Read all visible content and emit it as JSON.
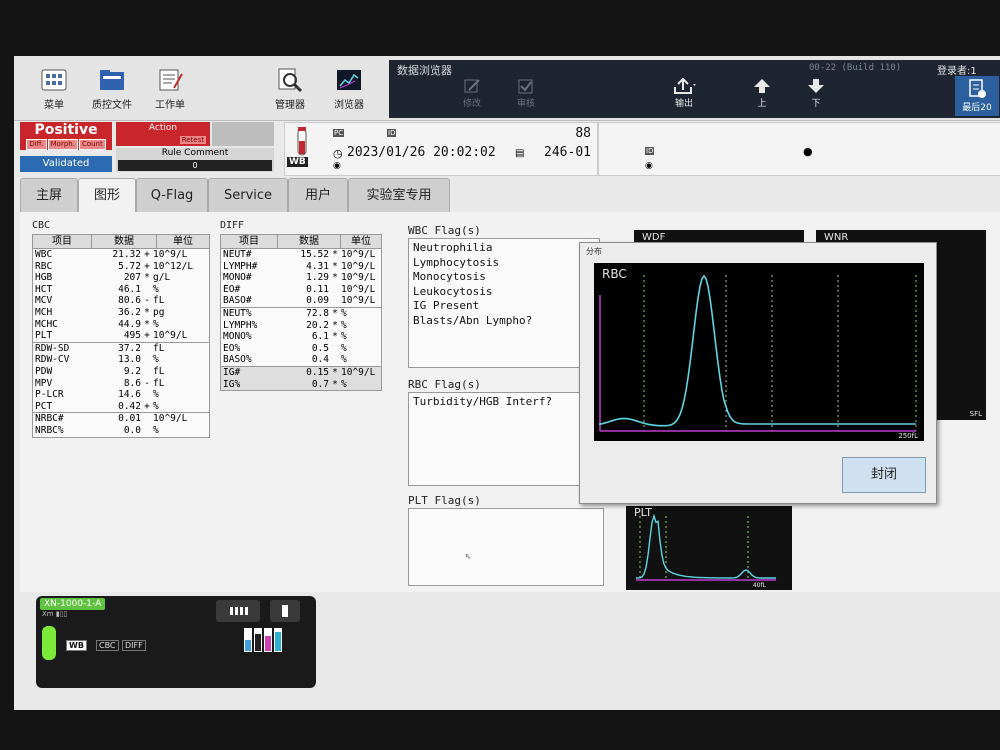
{
  "toolbar": {
    "items": [
      {
        "label": "菜单",
        "icon": "menu-grid-icon"
      },
      {
        "label": "质控文件",
        "icon": "qc-folder-icon"
      },
      {
        "label": "工作单",
        "icon": "worklist-icon"
      },
      {
        "label": "管理器",
        "icon": "manager-magnifier-icon"
      },
      {
        "label": "浏览器",
        "icon": "browser-chart-icon"
      }
    ]
  },
  "browser_bar": {
    "title": "数据浏览器",
    "build": "00-22 (Build 110)",
    "registered": "登录者:1",
    "actions": [
      {
        "label": "修改",
        "enabled": false
      },
      {
        "label": "审核",
        "enabled": false
      },
      {
        "label": "输出",
        "enabled": true
      },
      {
        "label": "上",
        "enabled": true
      },
      {
        "label": "下",
        "enabled": true
      }
    ],
    "last20_label": "最后20"
  },
  "status": {
    "result": "Positive",
    "chips": [
      "Diff.",
      "Morph.",
      "Count"
    ],
    "validated": "Validated",
    "action": "Action",
    "retest": "Retest",
    "rule_comment_label": "Rule Comment",
    "rule_comment_value": "0"
  },
  "sample": {
    "type": "WB",
    "seq": "88",
    "datetime": "2023/01/26 20:02:02",
    "rack": "246-01"
  },
  "tabs": [
    "主屏",
    "图形",
    "Q-Flag",
    "Service",
    "用户",
    "实验室专用"
  ],
  "active_tab": "图形",
  "cbc": {
    "title": "CBC",
    "headers": [
      "项目",
      "数据",
      "单位"
    ],
    "rows": [
      {
        "name": "WBC",
        "value": "21.32",
        "flag": "+",
        "unit": "10^9/L"
      },
      {
        "name": "RBC",
        "value": "5.72",
        "flag": "+",
        "unit": "10^12/L"
      },
      {
        "name": "HGB",
        "value": "207",
        "flag": "*",
        "unit": "g/L"
      },
      {
        "name": "HCT",
        "value": "46.1",
        "flag": "",
        "unit": "%"
      },
      {
        "name": "MCV",
        "value": "80.6",
        "flag": "-",
        "unit": "fL"
      },
      {
        "name": "MCH",
        "value": "36.2",
        "flag": "*",
        "unit": "pg"
      },
      {
        "name": "MCHC",
        "value": "44.9",
        "flag": "*",
        "unit": "%"
      },
      {
        "name": "PLT",
        "value": "495",
        "flag": "+",
        "unit": "10^9/L"
      },
      {
        "name": "RDW-SD",
        "value": "37.2",
        "flag": "",
        "unit": "fL"
      },
      {
        "name": "RDW-CV",
        "value": "13.0",
        "flag": "",
        "unit": "%"
      },
      {
        "name": "PDW",
        "value": "9.2",
        "flag": "",
        "unit": "fL"
      },
      {
        "name": "MPV",
        "value": "8.6",
        "flag": "-",
        "unit": "fL"
      },
      {
        "name": "P-LCR",
        "value": "14.6",
        "flag": "",
        "unit": "%"
      },
      {
        "name": "PCT",
        "value": "0.42",
        "flag": "+",
        "unit": "%"
      },
      {
        "name": "NRBC#",
        "value": "0.01",
        "flag": "",
        "unit": "10^9/L"
      },
      {
        "name": "NRBC%",
        "value": "0.0",
        "flag": "",
        "unit": "%"
      }
    ]
  },
  "diff": {
    "title": "DIFF",
    "headers": [
      "项目",
      "数据",
      "单位"
    ],
    "rows": [
      {
        "name": "NEUT#",
        "value": "15.52",
        "flag": "*",
        "unit": "10^9/L"
      },
      {
        "name": "LYMPH#",
        "value": "4.31",
        "flag": "*",
        "unit": "10^9/L"
      },
      {
        "name": "MONO#",
        "value": "1.29",
        "flag": "*",
        "unit": "10^9/L"
      },
      {
        "name": "EO#",
        "value": "0.11",
        "flag": "",
        "unit": "10^9/L"
      },
      {
        "name": "BASO#",
        "value": "0.09",
        "flag": "",
        "unit": "10^9/L"
      },
      {
        "name": "NEUT%",
        "value": "72.8",
        "flag": "*",
        "unit": "%"
      },
      {
        "name": "LYMPH%",
        "value": "20.2",
        "flag": "*",
        "unit": "%"
      },
      {
        "name": "MONO%",
        "value": "6.1",
        "flag": "*",
        "unit": "%"
      },
      {
        "name": "EO%",
        "value": "0.5",
        "flag": "",
        "unit": "%"
      },
      {
        "name": "BASO%",
        "value": "0.4",
        "flag": "",
        "unit": "%"
      },
      {
        "name": "IG#",
        "value": "0.15",
        "flag": "*",
        "unit": "10^9/L"
      },
      {
        "name": "IG%",
        "value": "0.7",
        "flag": "*",
        "unit": "%"
      }
    ]
  },
  "wbc_flags": {
    "title": "WBC Flag(s)",
    "items": [
      "Neutrophilia",
      "Lymphocytosis",
      "Monocytosis",
      "Leukocytosis",
      "IG Present",
      "Blasts/Abn Lympho?"
    ]
  },
  "rbc_flags": {
    "title": "RBC Flag(s)",
    "items": [
      "Turbidity/HGB Interf?"
    ]
  },
  "plt_flags": {
    "title": "PLT Flag(s)",
    "items": []
  },
  "scatter_panels": {
    "wdf": "WDF",
    "wnr": "WNR",
    "sfl": "SFL"
  },
  "popup": {
    "title": "分布",
    "plot_label": "RBC",
    "axis_label": "250fL",
    "close_label": "封闭"
  },
  "plt_graph": {
    "label": "PLT",
    "axis_label": "40fL"
  },
  "device": {
    "name": "XN-1000-1-A",
    "chips": [
      "WB",
      "CBC",
      "DIFF"
    ]
  },
  "colors": {
    "positive": "#c8262b",
    "validated": "#2c6ab3",
    "curve": "#5fd6e6",
    "gate": "#7ed957",
    "axis": "#c03cd0"
  }
}
